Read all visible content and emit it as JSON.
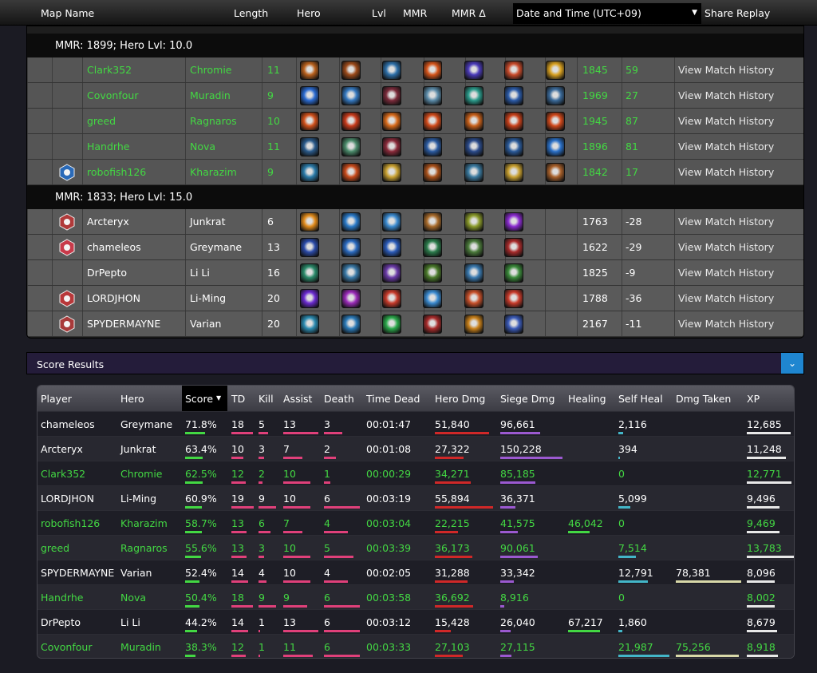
{
  "header": {
    "columns": [
      "Map Name",
      "Length",
      "Hero",
      "Lvl",
      "MMR",
      "MMR Δ"
    ],
    "datetime_select": "Date and Time (UTC+09)",
    "share_replay": "Share Replay"
  },
  "colors": {
    "win_text": "#43d843",
    "lose_text": "#ffffff",
    "accent_blue": "#1f86d0"
  },
  "teams": [
    {
      "header": "MMR: 1899; Hero Lvl: 10.0",
      "result": "win",
      "players": [
        {
          "name": "Clark352",
          "hero": "Chromie",
          "lvl": "11",
          "mmr": "1845",
          "mmr_delta": "59",
          "link": "View Match History",
          "badge": null,
          "talents": [
            "#b8601c",
            "#9c4a1a",
            "#2d6fa8",
            "#d4541a",
            "#4a3ab8",
            "#c84a2a",
            "#d8a020"
          ]
        },
        {
          "name": "Covonfour",
          "hero": "Muradin",
          "lvl": "9",
          "mmr": "1969",
          "mmr_delta": "27",
          "link": "View Match History",
          "badge": null,
          "talents": [
            "#2a6ad0",
            "#3478c0",
            "#7a2a3a",
            "#5a8aa8",
            "#2a9a8a",
            "#2a5aa8",
            "#3a6a9a"
          ]
        },
        {
          "name": "greed",
          "hero": "Ragnaros",
          "lvl": "10",
          "mmr": "1945",
          "mmr_delta": "87",
          "link": "View Match History",
          "badge": null,
          "talents": [
            "#d0501a",
            "#c83a1a",
            "#d86a1a",
            "#d04a1a",
            "#c8601a",
            "#c8401a",
            "#d0481a"
          ]
        },
        {
          "name": "Handrhe",
          "hero": "Nova",
          "lvl": "11",
          "mmr": "1896",
          "mmr_delta": "81",
          "link": "View Match History",
          "badge": null,
          "talents": [
            "#2a5a8a",
            "#4a8a6a",
            "#8a2a3a",
            "#2a5aa0",
            "#2a4a8a",
            "#2a5a9a",
            "#2a70c8"
          ]
        },
        {
          "name": "robofish126",
          "hero": "Kharazim",
          "lvl": "9",
          "mmr": "1842",
          "mmr_delta": "17",
          "link": "View Match History",
          "badge": "shield-blue",
          "talents": [
            "#2a7aa8",
            "#c84a1a",
            "#c8a030",
            "#a8501a",
            "#3a7aa0",
            "#c8a030",
            "#a8602a"
          ]
        }
      ]
    },
    {
      "header": "MMR: 1833; Hero Lvl: 15.0",
      "result": "lose",
      "players": [
        {
          "name": "Arcteryx",
          "hero": "Junkrat",
          "lvl": "6",
          "mmr": "1763",
          "mmr_delta": "-28",
          "link": "View Match History",
          "badge": "red-emblem",
          "talents": [
            "#e08a1a",
            "#2a7ac8",
            "#3a8ad0",
            "#a86a2a",
            "#8a9a2a",
            "#8a2ad0"
          ]
        },
        {
          "name": "chameleos",
          "hero": "Greymane",
          "lvl": "13",
          "mmr": "1622",
          "mmr_delta": "-29",
          "link": "View Match History",
          "badge": "red-hex",
          "talents": [
            "#2a4aa8",
            "#2a6ac0",
            "#2a5ab8",
            "#2a7a4a",
            "#4a7a3a",
            "#a82a2a"
          ]
        },
        {
          "name": "DrPepto",
          "hero": "Li Li",
          "lvl": "16",
          "mmr": "1825",
          "mmr_delta": "-9",
          "link": "View Match History",
          "badge": null,
          "talents": [
            "#2a8a6a",
            "#3a7aa8",
            "#6a3aa8",
            "#4a7a2a",
            "#3a7ab0",
            "#3a8a3a"
          ]
        },
        {
          "name": "LORDJHON",
          "hero": "Li-Ming",
          "lvl": "20",
          "mmr": "1788",
          "mmr_delta": "-36",
          "link": "View Match History",
          "badge": "red-axes",
          "talents": [
            "#6a2ad0",
            "#9a2ab8",
            "#c83a2a",
            "#3a8ad0",
            "#c8502a",
            "#c83a2a"
          ]
        },
        {
          "name": "SPYDERMAYNE",
          "hero": "Varian",
          "lvl": "20",
          "mmr": "2167",
          "mmr_delta": "-11",
          "link": "View Match History",
          "badge": "red-crest",
          "talents": [
            "#2a8ab0",
            "#2a7ab8",
            "#2aa84a",
            "#a82a2a",
            "#c8801a",
            "#3a5ab8"
          ]
        }
      ]
    }
  ],
  "score_results": {
    "title": "Score Results",
    "toggle_icon": "chevron-down",
    "columns": [
      "Player",
      "Hero",
      "Score",
      "TD",
      "Kill",
      "Assist",
      "Death",
      "Time Dead",
      "Hero Dmg",
      "Siege Dmg",
      "Healing",
      "Self Heal",
      "Dmg Taken",
      "XP"
    ],
    "sorted_column": "Score",
    "rows": [
      {
        "player": "chameleos",
        "hero": "Greymane",
        "score": "71.8%",
        "td": "18",
        "kill": "5",
        "assist": "13",
        "death": "3",
        "time_dead": "00:01:47",
        "hero_dmg": "51,840",
        "siege_dmg": "96,661",
        "healing": "",
        "self_heal": "2,116",
        "dmg_taken": "",
        "xp": "12,685",
        "result": "lose",
        "bars": {
          "score": 0.72,
          "td": 0.95,
          "kill": 0.56,
          "assist": 1.0,
          "death": 0.5,
          "hero_dmg": 0.93,
          "siege_dmg": 0.64,
          "healing": 0,
          "self_heal": 0.1,
          "dmg_taken": 0,
          "xp": 0.92
        }
      },
      {
        "player": "Arcteryx",
        "hero": "Junkrat",
        "score": "63.4%",
        "td": "10",
        "kill": "3",
        "assist": "7",
        "death": "2",
        "time_dead": "00:01:08",
        "hero_dmg": "27,322",
        "siege_dmg": "150,228",
        "healing": "",
        "self_heal": "394",
        "dmg_taken": "",
        "xp": "11,248",
        "result": "lose",
        "bars": {
          "score": 0.63,
          "td": 0.53,
          "kill": 0.33,
          "assist": 0.54,
          "death": 0.33,
          "hero_dmg": 0.49,
          "siege_dmg": 1.0,
          "healing": 0,
          "self_heal": 0.02,
          "dmg_taken": 0,
          "xp": 0.82
        }
      },
      {
        "player": "Clark352",
        "hero": "Chromie",
        "score": "62.5%",
        "td": "12",
        "kill": "2",
        "assist": "10",
        "death": "1",
        "time_dead": "00:00:29",
        "hero_dmg": "34,271",
        "siege_dmg": "85,185",
        "healing": "",
        "self_heal": "0",
        "dmg_taken": "",
        "xp": "12,771",
        "result": "win",
        "bars": {
          "score": 0.62,
          "td": 0.63,
          "kill": 0.22,
          "assist": 0.77,
          "death": 0.17,
          "hero_dmg": 0.62,
          "siege_dmg": 0.57,
          "healing": 0,
          "self_heal": 0,
          "dmg_taken": 0,
          "xp": 0.93
        }
      },
      {
        "player": "LORDJHON",
        "hero": "Li-Ming",
        "score": "60.9%",
        "td": "19",
        "kill": "9",
        "assist": "10",
        "death": "6",
        "time_dead": "00:03:19",
        "hero_dmg": "55,894",
        "siege_dmg": "36,371",
        "healing": "",
        "self_heal": "5,099",
        "dmg_taken": "",
        "xp": "9,496",
        "result": "lose",
        "bars": {
          "score": 0.61,
          "td": 1.0,
          "kill": 1.0,
          "assist": 0.77,
          "death": 1.0,
          "hero_dmg": 1.0,
          "siege_dmg": 0.24,
          "healing": 0,
          "self_heal": 0.23,
          "dmg_taken": 0,
          "xp": 0.69
        }
      },
      {
        "player": "robofish126",
        "hero": "Kharazim",
        "score": "58.7%",
        "td": "13",
        "kill": "6",
        "assist": "7",
        "death": "4",
        "time_dead": "00:03:04",
        "hero_dmg": "22,215",
        "siege_dmg": "41,575",
        "healing": "46,042",
        "self_heal": "0",
        "dmg_taken": "",
        "xp": "9,469",
        "result": "win",
        "bars": {
          "score": 0.59,
          "td": 0.68,
          "kill": 0.67,
          "assist": 0.54,
          "death": 0.67,
          "hero_dmg": 0.4,
          "siege_dmg": 0.28,
          "healing": 0.68,
          "self_heal": 0,
          "dmg_taken": 0,
          "xp": 0.69
        }
      },
      {
        "player": "greed",
        "hero": "Ragnaros",
        "score": "55.6%",
        "td": "13",
        "kill": "3",
        "assist": "10",
        "death": "5",
        "time_dead": "00:03:39",
        "hero_dmg": "36,173",
        "siege_dmg": "90,061",
        "healing": "",
        "self_heal": "7,514",
        "dmg_taken": "",
        "xp": "13,783",
        "result": "win",
        "bars": {
          "score": 0.56,
          "td": 0.68,
          "kill": 0.33,
          "assist": 0.77,
          "death": 0.83,
          "hero_dmg": 0.65,
          "siege_dmg": 0.6,
          "healing": 0,
          "self_heal": 0.34,
          "dmg_taken": 0,
          "xp": 1.0
        }
      },
      {
        "player": "SPYDERMAYNE",
        "hero": "Varian",
        "score": "52.4%",
        "td": "14",
        "kill": "4",
        "assist": "10",
        "death": "4",
        "time_dead": "00:02:05",
        "hero_dmg": "31,288",
        "siege_dmg": "33,342",
        "healing": "",
        "self_heal": "12,791",
        "dmg_taken": "78,381",
        "xp": "8,096",
        "result": "lose",
        "bars": {
          "score": 0.52,
          "td": 0.74,
          "kill": 0.44,
          "assist": 0.77,
          "death": 0.67,
          "hero_dmg": 0.56,
          "siege_dmg": 0.22,
          "healing": 0,
          "self_heal": 0.58,
          "dmg_taken": 1.0,
          "xp": 0.59
        }
      },
      {
        "player": "Handrhe",
        "hero": "Nova",
        "score": "50.4%",
        "td": "18",
        "kill": "9",
        "assist": "9",
        "death": "6",
        "time_dead": "00:03:58",
        "hero_dmg": "36,692",
        "siege_dmg": "8,916",
        "healing": "",
        "self_heal": "0",
        "dmg_taken": "",
        "xp": "8,002",
        "result": "win",
        "bars": {
          "score": 0.5,
          "td": 0.95,
          "kill": 1.0,
          "assist": 0.69,
          "death": 1.0,
          "hero_dmg": 0.66,
          "siege_dmg": 0.06,
          "healing": 0,
          "self_heal": 0,
          "dmg_taken": 0,
          "xp": 0.58
        }
      },
      {
        "player": "DrPepto",
        "hero": "Li Li",
        "score": "44.2%",
        "td": "14",
        "kill": "1",
        "assist": "13",
        "death": "6",
        "time_dead": "00:03:12",
        "hero_dmg": "15,428",
        "siege_dmg": "26,040",
        "healing": "67,217",
        "self_heal": "1,860",
        "dmg_taken": "",
        "xp": "8,679",
        "result": "lose",
        "bars": {
          "score": 0.44,
          "td": 0.74,
          "kill": 0.11,
          "assist": 1.0,
          "death": 1.0,
          "hero_dmg": 0.28,
          "siege_dmg": 0.17,
          "healing": 1.0,
          "self_heal": 0.08,
          "dmg_taken": 0,
          "xp": 0.63
        }
      },
      {
        "player": "Covonfour",
        "hero": "Muradin",
        "score": "38.3%",
        "td": "12",
        "kill": "1",
        "assist": "11",
        "death": "6",
        "time_dead": "00:03:33",
        "hero_dmg": "27,103",
        "siege_dmg": "27,115",
        "healing": "",
        "self_heal": "21,987",
        "dmg_taken": "75,256",
        "xp": "8,918",
        "result": "win",
        "bars": {
          "score": 0.38,
          "td": 0.63,
          "kill": 0.11,
          "assist": 0.85,
          "death": 1.0,
          "hero_dmg": 0.48,
          "siege_dmg": 0.18,
          "healing": 0,
          "self_heal": 1.0,
          "dmg_taken": 0.96,
          "xp": 0.65
        }
      }
    ]
  }
}
